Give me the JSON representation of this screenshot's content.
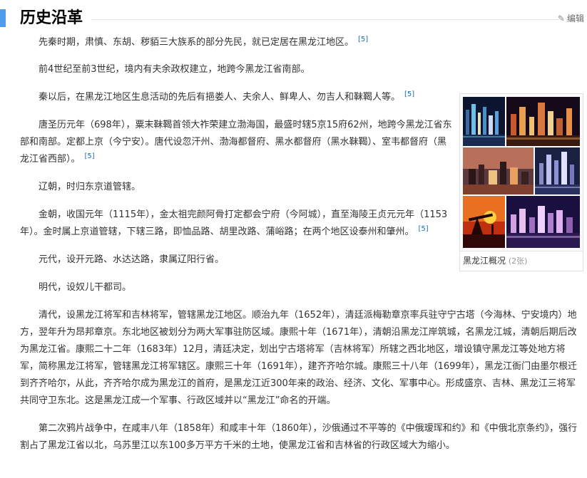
{
  "section": {
    "title": "历史沿革",
    "edit_label": "编辑",
    "edit_icon": "pencil-icon",
    "accent_color": "#4f9cee"
  },
  "album": {
    "caption": "黑龙江概况",
    "count": "(2张)"
  },
  "paragraphs": [
    {
      "text": "先秦时期，肃慎、东胡、秽貊三大族系的部分先民，就已定居在黑龙江地区。",
      "ref": "[5]"
    },
    {
      "text": "前4世纪至前3世纪，境内有夫余政权建立，地跨今黑龙江省南部。",
      "ref": ""
    },
    {
      "text": "秦以后，在黑龙江地区生息活动的先后有挹娄人、夫余人、鲜卑人、勿吉人和靺鞨人等。",
      "ref": "[5]"
    },
    {
      "text": "唐圣历元年（698年），粟末靺鞨首领大祚荣建立渤海国，最盛时辖5京15府62州，地跨今黑龙江省东部和南部。定都上京（今宁安）。唐代设忽汗州、渤海都督府、黑水都督府（黑水靺鞨）、室韦都督府（黑龙江省西部）。",
      "ref": "[5]"
    },
    {
      "text": "辽朝，时归东京道管辖。",
      "ref": ""
    },
    {
      "text": "金朝，收国元年（1115年），金太祖完颜阿骨打定都会宁府（今阿城），直至海陵王贞元元年（1153年）。金时属上京道管辖，下辖三路，即恤品路、胡里改路、蒲峪路；在两个地区设泰州和肇州。",
      "ref": "[5]"
    },
    {
      "text": "元代，设开元路、水达达路，隶属辽阳行省。",
      "ref": ""
    },
    {
      "text": "明代，设奴儿干都司。",
      "ref": ""
    },
    {
      "text": "清代，设黑龙江将军和吉林将军，管辖黑龙江地区。顺治九年（1652年），清廷派梅勒章京率兵驻守宁古塔（今海林、宁安境内）地方，翌年升为昂邦章京。东北地区被划分为两大军事驻防区域。康熙十年（1671年），清朝沿黑龙江岸筑城，名黑龙江城，清朝后期后改为黑龙江省。康熙二十二年（1683年）12月，清廷决定，划出宁古塔将军（吉林将军）所辖之西北地区，增设镇守黑龙江等处地方将军，简称黑龙江将军，管辖黑龙江将军辖区。康熙三十年（1691年），建齐齐哈尔城。康熙三十八年（1699年），黑龙江衙门由墨尔根迁到齐齐哈尔，从此，齐齐哈尔成为黑龙江的首府，是黑龙江近300年来的政治、经济、文化、军事中心。形成盛京、吉林、黑龙江三将军共同守卫东北。这是黑龙江成一个军事、行政区域并以“黑龙江”命名的开端。",
      "ref": ""
    },
    {
      "text": "第二次鸦片战争中，在咸丰八年（1858年）和咸丰十年（1860年），沙俄通过不平等的《中俄瑷珲和约》和《中俄北京条约》，强行割占了黑龙江省以北，乌苏里江以东100多万平方千米的土地，使黑龙江省和吉林省的行政区域大为缩小。",
      "ref": ""
    }
  ]
}
